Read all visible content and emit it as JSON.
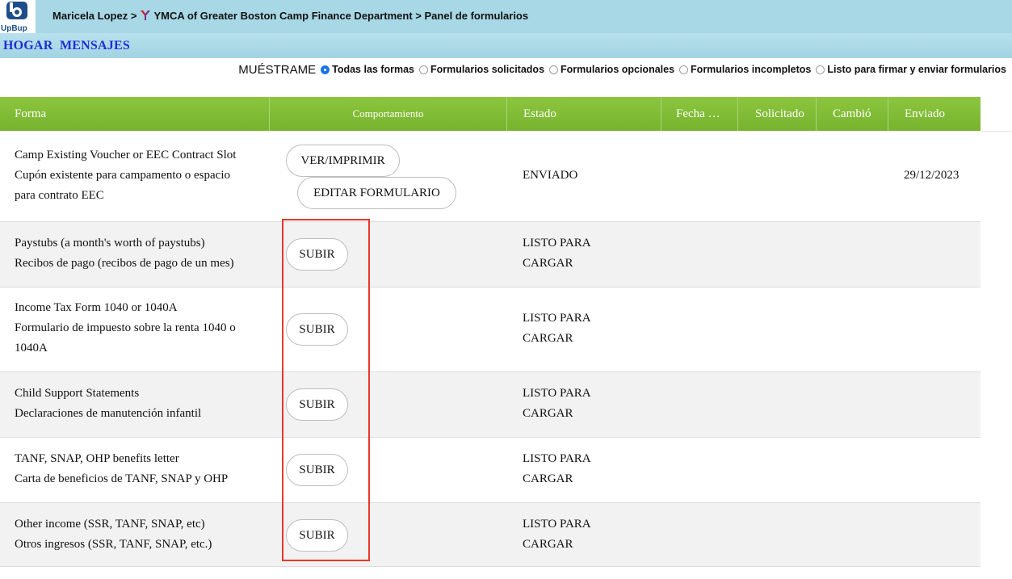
{
  "header": {
    "logo_text": "UpBup",
    "user": "Maricela Lopez",
    "separator": ">",
    "organization": "YMCA of Greater Boston Camp Finance Department",
    "page": "Panel de formularios"
  },
  "nav": {
    "home": "HOGAR",
    "messages": "MENSAJES"
  },
  "filters": {
    "label": "MUÉSTRAME",
    "selected": "Todas las formas",
    "options": [
      "Todas las formas",
      "Formularios solicitados",
      "Formularios opcionales",
      "Formularios incompletos",
      "Listo para firmar y enviar formularios"
    ]
  },
  "table": {
    "headers": [
      "Forma",
      "Comportamiento",
      "Estado",
      "Fecha …",
      "Solicitado",
      "Cambió",
      "Enviado"
    ],
    "rows": [
      {
        "form_lines": [
          "Camp Existing Voucher or EEC Contract Slot",
          "Cupón existente para campamento o espacio",
          "para contrato EEC"
        ],
        "actions": [
          "VER/IMPRIMIR",
          "EDITAR FORMULARIO"
        ],
        "status_lines": [
          "ENVIADO"
        ],
        "sent": "29/12/2023"
      },
      {
        "form_lines": [
          "Paystubs (a month's worth of paystubs)",
          "Recibos de pago (recibos de pago de un mes)"
        ],
        "actions": [
          "SUBIR"
        ],
        "status_lines": [
          "LISTO PARA",
          "CARGAR"
        ],
        "sent": ""
      },
      {
        "form_lines": [
          "Income Tax Form 1040 or 1040A",
          "Formulario de impuesto sobre la renta 1040 o",
          "1040A"
        ],
        "actions": [
          "SUBIR"
        ],
        "status_lines": [
          "LISTO PARA",
          "CARGAR"
        ],
        "sent": ""
      },
      {
        "form_lines": [
          "Child Support Statements",
          "Declaraciones de manutención infantil"
        ],
        "actions": [
          "SUBIR"
        ],
        "status_lines": [
          "LISTO PARA",
          "CARGAR"
        ],
        "sent": ""
      },
      {
        "form_lines": [
          "TANF, SNAP, OHP benefits letter",
          "Carta de beneficios de TANF, SNAP y OHP"
        ],
        "actions": [
          "SUBIR"
        ],
        "status_lines": [
          "LISTO PARA",
          "CARGAR"
        ],
        "sent": ""
      },
      {
        "form_lines": [
          "Other income (SSR, TANF, SNAP, etc)",
          "Otros ingresos (SSR, TANF, SNAP, etc.)"
        ],
        "actions": [
          "SUBIR"
        ],
        "status_lines": [
          "LISTO PARA",
          "CARGAR"
        ],
        "sent": ""
      }
    ]
  },
  "colors": {
    "header_bg": "#a8d8e6",
    "table_header_green": "#80bd37",
    "nav_link": "#1b2fd6",
    "highlight_red": "#e8372c"
  }
}
